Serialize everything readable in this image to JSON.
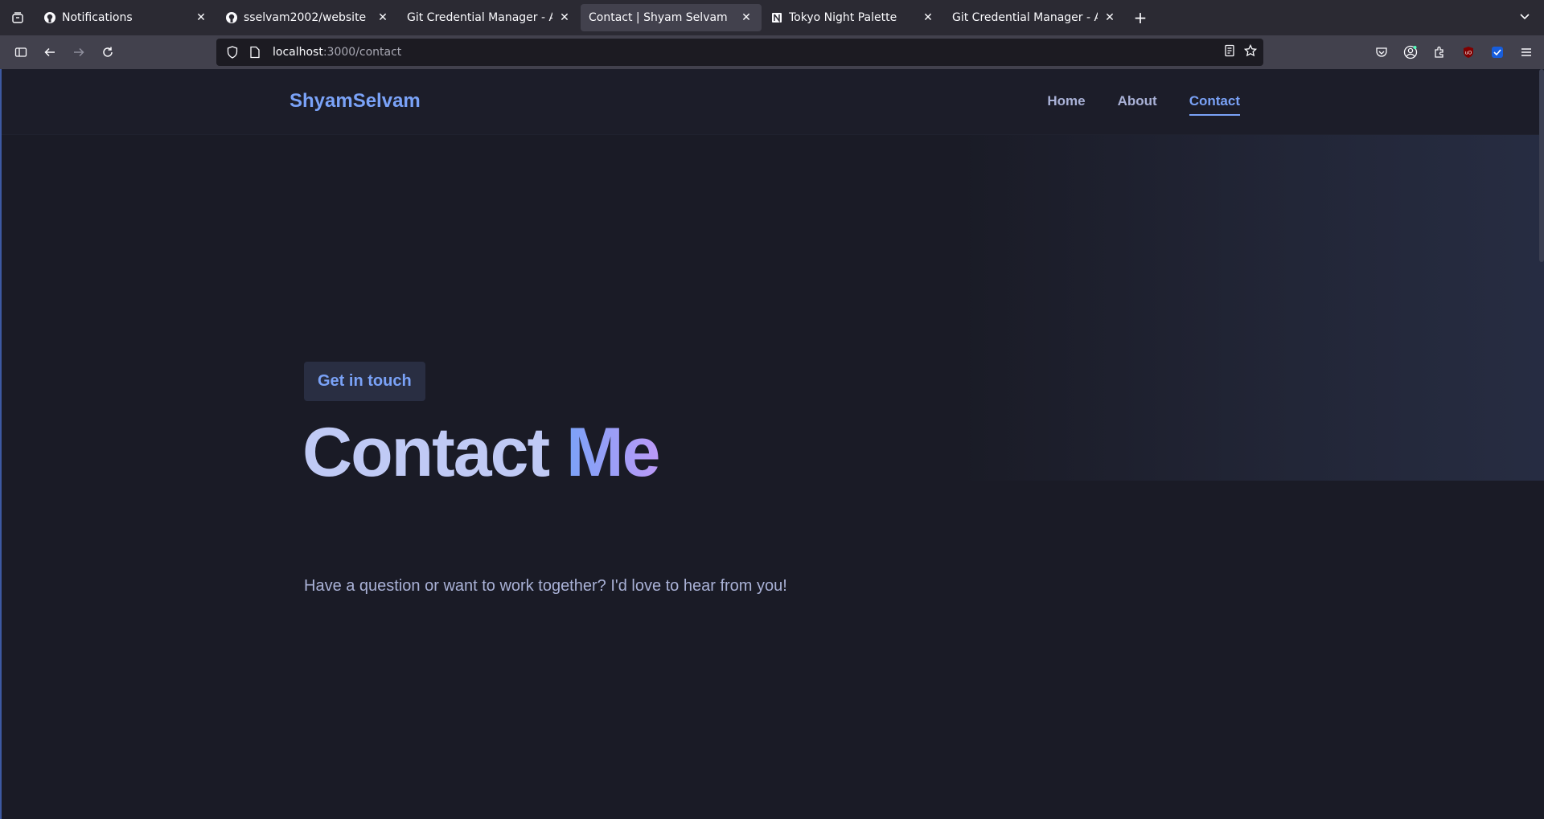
{
  "browser": {
    "tabs": [
      {
        "title": "Notifications",
        "icon": "github-icon",
        "active": false
      },
      {
        "title": "sselvam2002/website",
        "icon": "github-icon",
        "active": false
      },
      {
        "title": "Git Credential Manager - Auth",
        "icon": "none",
        "active": false
      },
      {
        "title": "Contact | Shyam Selvam",
        "icon": "none",
        "active": true
      },
      {
        "title": "Tokyo Night Palette",
        "icon": "notion-icon",
        "active": false
      },
      {
        "title": "Git Credential Manager - Auth",
        "icon": "none",
        "active": false
      }
    ],
    "url_host": "localhost",
    "url_rest": ":3000/contact"
  },
  "site": {
    "brand": "ShyamSelvam",
    "nav": [
      "Home",
      "About",
      "Contact"
    ],
    "active_nav": "Contact"
  },
  "hero": {
    "badge": "Get in touch",
    "title_main": "Contact",
    "title_accent": "Me",
    "subtitle": "Have a question or want to work together? I'd love to hear from you!"
  },
  "colors": {
    "background": "#1a1b26",
    "accent_blue": "#7aa2f7",
    "accent_purple": "#bb9af7",
    "text": "#c0caf5"
  }
}
